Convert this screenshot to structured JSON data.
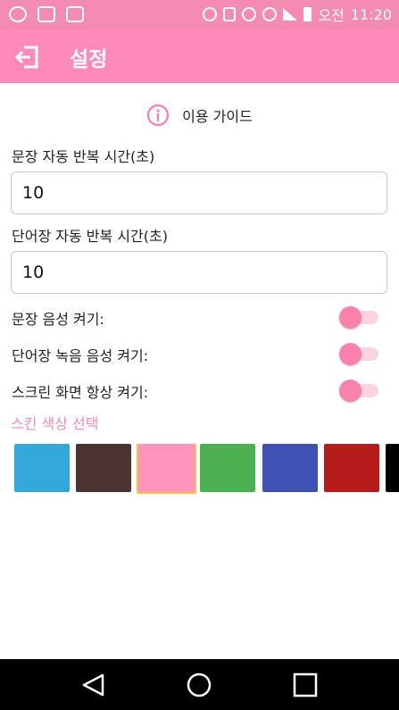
{
  "status_bar": {
    "left_icons": [
      "app-notification-icon",
      "chat-notification-icon",
      "image-notification-icon"
    ],
    "right_icons": [
      "bluetooth-icon",
      "vibrate-icon",
      "alarm-icon",
      "wifi-icon",
      "signal-icon",
      "battery-icon"
    ],
    "ampm": "오전",
    "time": "11:20"
  },
  "app_bar": {
    "title": "설정",
    "color": "#fd8ab8"
  },
  "guide": {
    "label": "이용 가이드"
  },
  "settings": {
    "sentence_repeat": {
      "label": "문장 자동 반복 시간(초)",
      "value": "10"
    },
    "word_repeat": {
      "label": "단어장 자동 반복 시간(초)",
      "value": "10"
    }
  },
  "toggles": [
    {
      "label": "문장 음성 켜기:",
      "on": false
    },
    {
      "label": "단어장 녹음 음성 켜기:",
      "on": false
    },
    {
      "label": "스크린 화면 항상 켜기:",
      "on": false
    }
  ],
  "skin": {
    "label": "스킨 색상 선택",
    "colors": [
      "#33a8d9",
      "#4c3434",
      "#fd95bd",
      "#4caf50",
      "#3f51b5",
      "#b71c1c",
      "#000000"
    ],
    "selected_index": 2
  },
  "nav_bar": {
    "buttons": [
      "back-icon",
      "home-icon",
      "recents-icon"
    ]
  }
}
